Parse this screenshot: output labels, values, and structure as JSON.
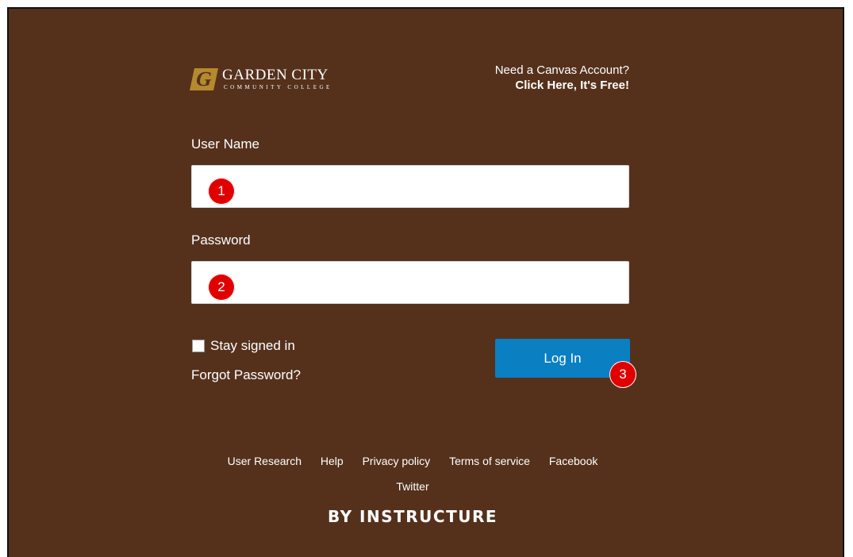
{
  "logo": {
    "mark": "G",
    "name": "GARDEN CITY",
    "subtitle": "COMMUNITY COLLEGE"
  },
  "signup": {
    "prompt": "Need a Canvas Account?",
    "link": "Click Here, It's Free!"
  },
  "form": {
    "username_label": "User Name",
    "username_value": "",
    "password_label": "Password",
    "password_value": "",
    "remember_label": "Stay signed in",
    "remember_checked": false,
    "forgot_label": "Forgot Password?",
    "login_label": "Log In"
  },
  "annotations": [
    "1",
    "2",
    "3"
  ],
  "footer": {
    "links": [
      "User Research",
      "Help",
      "Privacy policy",
      "Terms of service",
      "Facebook",
      "Twitter"
    ],
    "brand": "BY INSTRUCTURE"
  },
  "colors": {
    "background": "#55311c",
    "button": "#0a7fc2",
    "badge": "#e00000",
    "logo_gold": "#b58a2e"
  }
}
